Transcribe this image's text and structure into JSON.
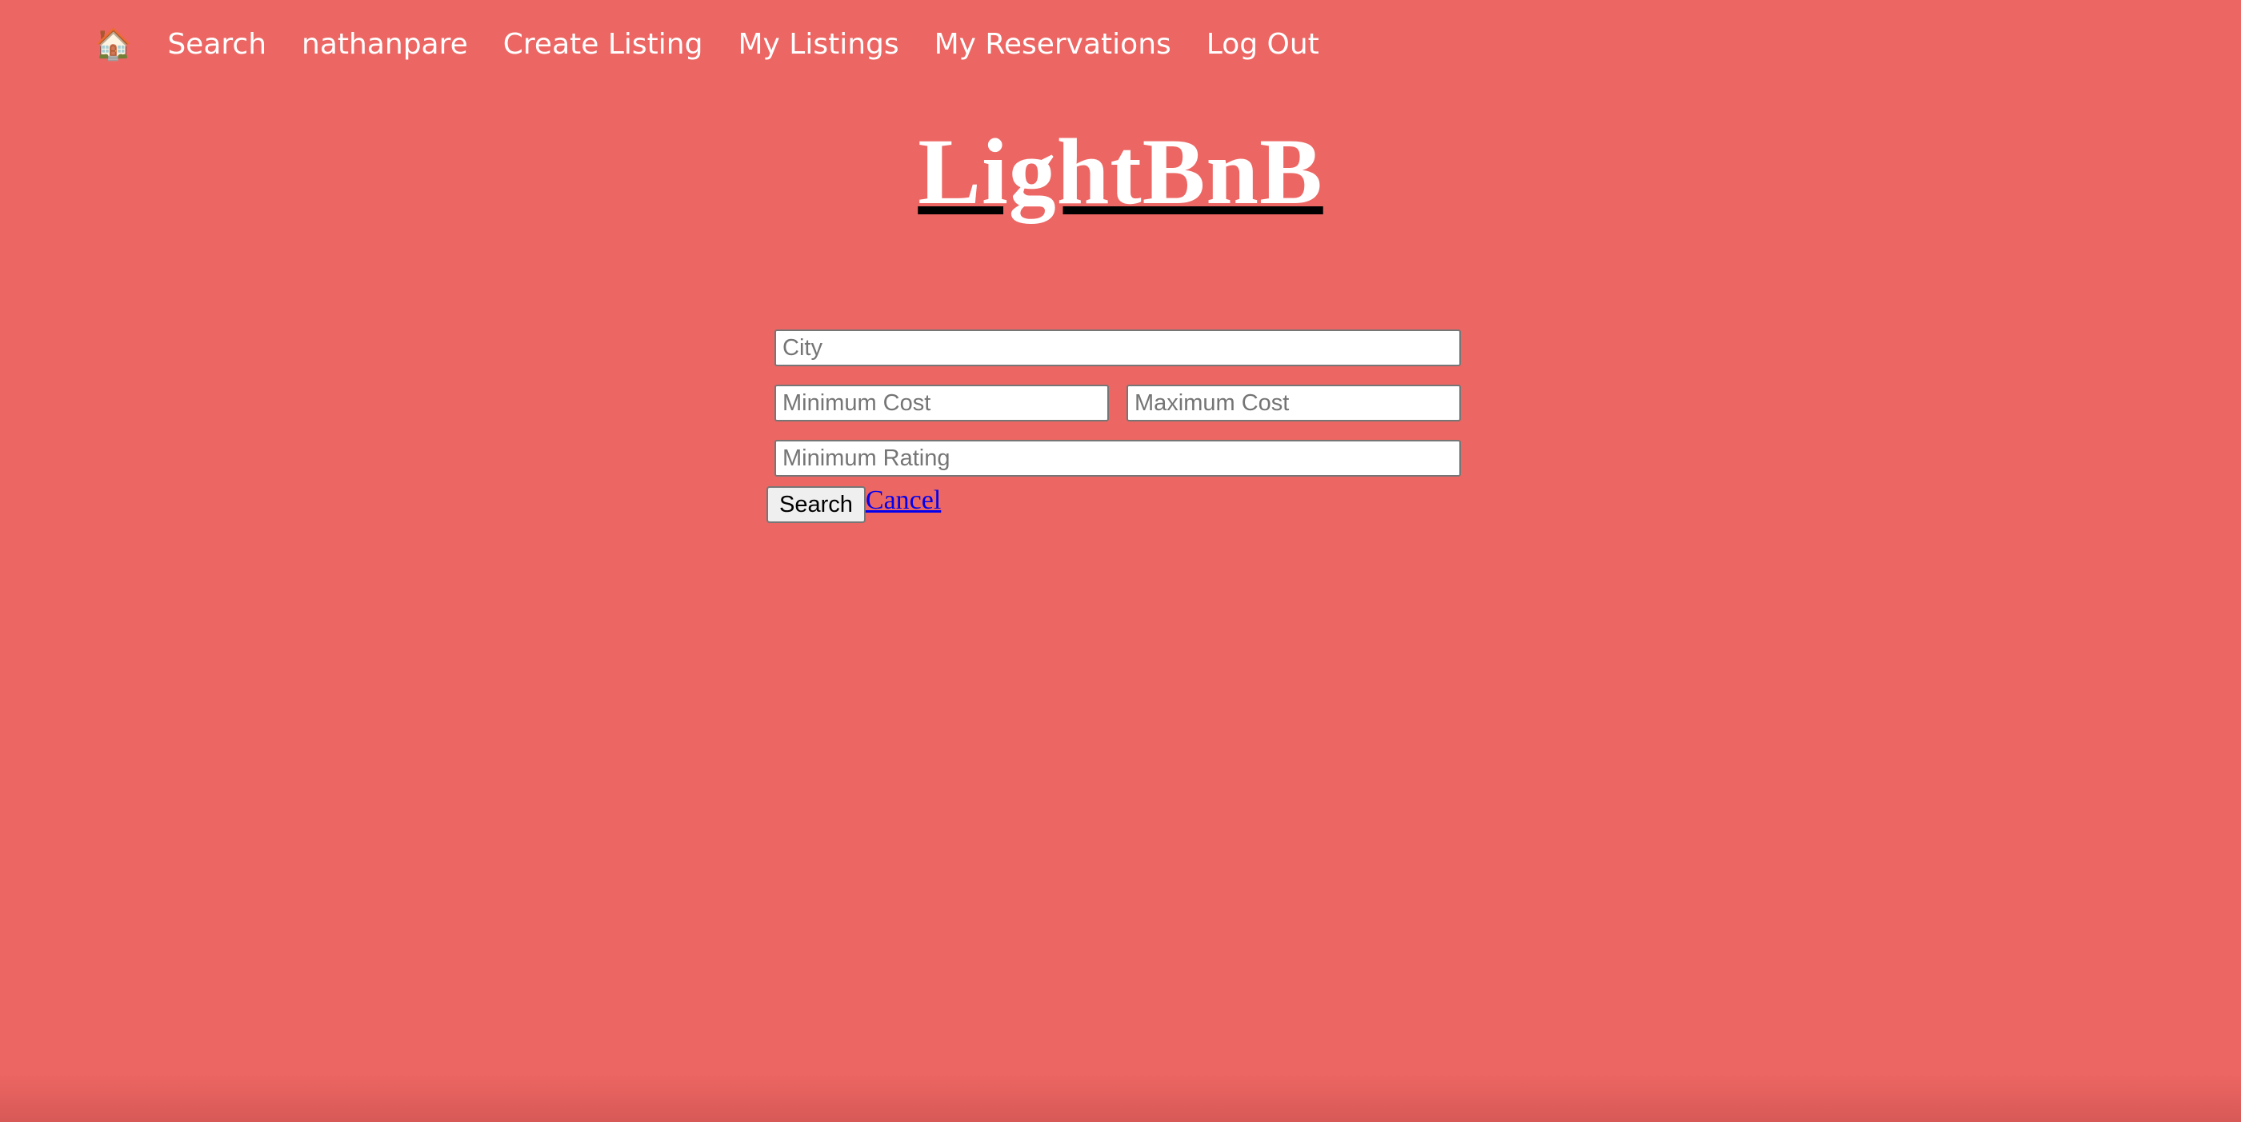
{
  "nav": {
    "home_icon": "🏠",
    "items": [
      {
        "label": "Search"
      },
      {
        "label": "nathanpare"
      },
      {
        "label": "Create Listing"
      },
      {
        "label": "My Listings"
      },
      {
        "label": "My Reservations"
      },
      {
        "label": "Log Out"
      }
    ]
  },
  "header": {
    "title": "LightBnB"
  },
  "search_form": {
    "city_placeholder": "City",
    "min_cost_placeholder": "Minimum Cost",
    "max_cost_placeholder": "Maximum Cost",
    "min_rating_placeholder": "Minimum Rating",
    "submit_label": "Search",
    "cancel_label": "Cancel"
  },
  "colors": {
    "background": "#ec6663",
    "nav_text": "#ffffff",
    "title_text": "#ffffff",
    "title_underline": "#000000",
    "link": "#0000ee"
  }
}
